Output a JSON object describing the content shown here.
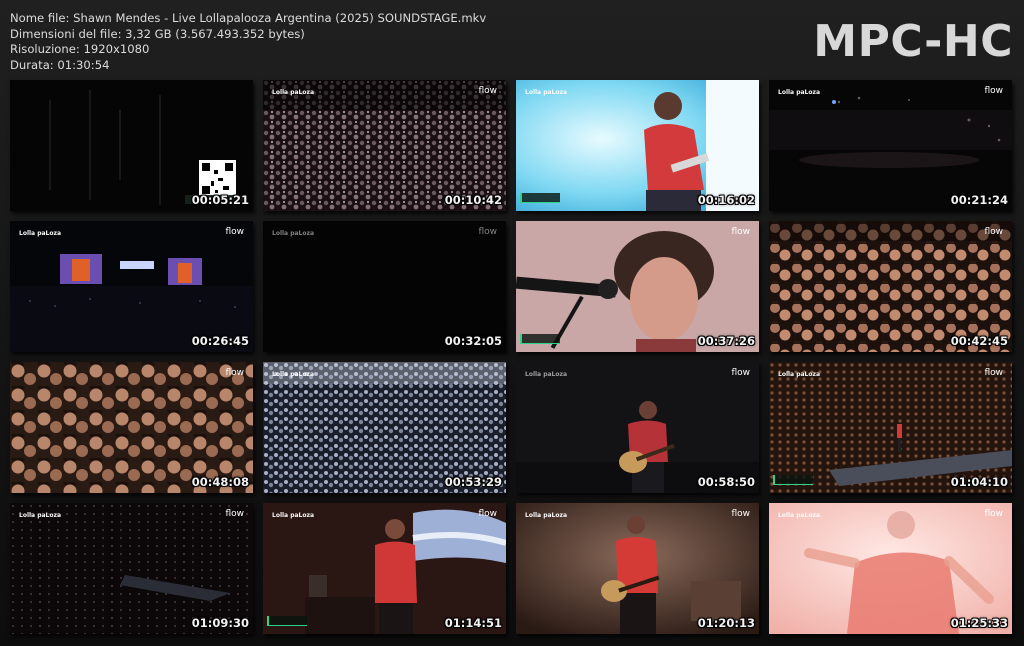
{
  "header": {
    "filename_line": "Nome file: Shawn Mendes - Live Lollapalooza Argentina (2025) SOUNDSTAGE.mkv",
    "filesize_line": "Dimensioni del file: 3,32 GB (3.567.493.352 bytes)",
    "resolution_line": "Risoluzione: 1920x1080",
    "duration_line": "Durata: 01:30:54"
  },
  "logo": "MPC-HC",
  "watermark": {
    "left_logo": "Lolla paLoza",
    "right_logo": "flow"
  },
  "colors": {
    "background": "#1a1a1a",
    "text": "#dcdcdc",
    "timestamp": "#f2f2f2",
    "badge_accent": "#2fd48a"
  },
  "thumbnails": [
    {
      "time": "00:05:21",
      "scene": "dark stage with QR code"
    },
    {
      "time": "00:10:42",
      "scene": "crowd at night"
    },
    {
      "time": "00:16:02",
      "scene": "singer in red shirt, bright blue light"
    },
    {
      "time": "00:21:24",
      "scene": "dark stadium crowd"
    },
    {
      "time": "00:26:45",
      "scene": "wide stage with screens"
    },
    {
      "time": "00:32:05",
      "scene": "black frame"
    },
    {
      "time": "00:37:26",
      "scene": "close-up singer at microphone"
    },
    {
      "time": "00:42:45",
      "scene": "front row crowd"
    },
    {
      "time": "00:48:08",
      "scene": "fans cheering"
    },
    {
      "time": "00:53:29",
      "scene": "crowd lit from above"
    },
    {
      "time": "00:58:50",
      "scene": "singer with acoustic guitar"
    },
    {
      "time": "01:04:10",
      "scene": "stage runway and crowd"
    },
    {
      "time": "01:09:30",
      "scene": "dark venue overview"
    },
    {
      "time": "01:14:51",
      "scene": "singer with mic and flag"
    },
    {
      "time": "01:20:13",
      "scene": "singer with guitar, red lighting"
    },
    {
      "time": "01:25:33",
      "scene": "overexposed singer silhouette"
    }
  ]
}
